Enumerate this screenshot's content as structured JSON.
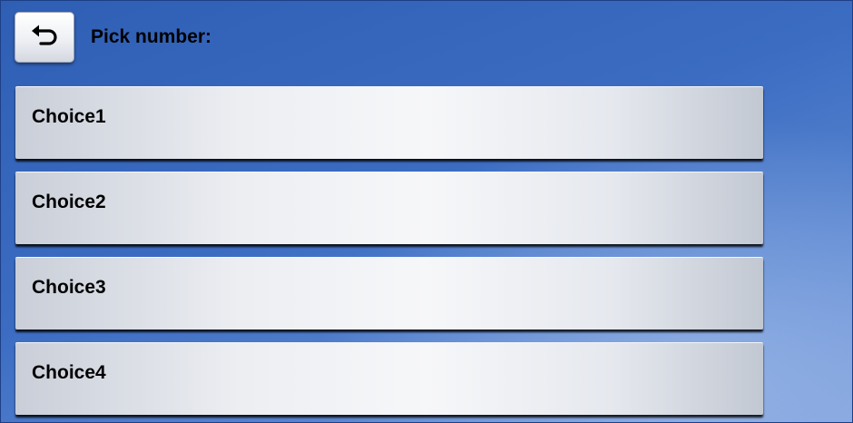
{
  "header": {
    "back_icon": "back-arrow-icon",
    "title": "Pick number:"
  },
  "choices": [
    {
      "label": "Choice1"
    },
    {
      "label": "Choice2"
    },
    {
      "label": "Choice3"
    },
    {
      "label": "Choice4"
    }
  ],
  "colors": {
    "background_top": "#2f5fb4",
    "background_bottom": "#7f9fdc",
    "button_face": "#eceef2",
    "text": "#000000"
  }
}
